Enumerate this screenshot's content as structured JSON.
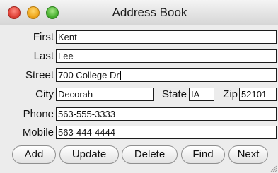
{
  "window": {
    "title": "Address Book"
  },
  "form": {
    "first": {
      "label": "First",
      "value": "Kent"
    },
    "last": {
      "label": "Last",
      "value": "Lee"
    },
    "street": {
      "label": "Street",
      "value": "700 College Dr"
    },
    "city": {
      "label": "City",
      "value": "Decorah"
    },
    "state": {
      "label": "State",
      "value": "IA"
    },
    "zip": {
      "label": "Zip",
      "value": "52101"
    },
    "phone": {
      "label": "Phone",
      "value": "563-555-3333"
    },
    "mobile": {
      "label": "Mobile",
      "value": "563-444-4444"
    }
  },
  "buttons": {
    "add": "Add",
    "update": "Update",
    "delete": "Delete",
    "find": "Find",
    "next": "Next"
  }
}
